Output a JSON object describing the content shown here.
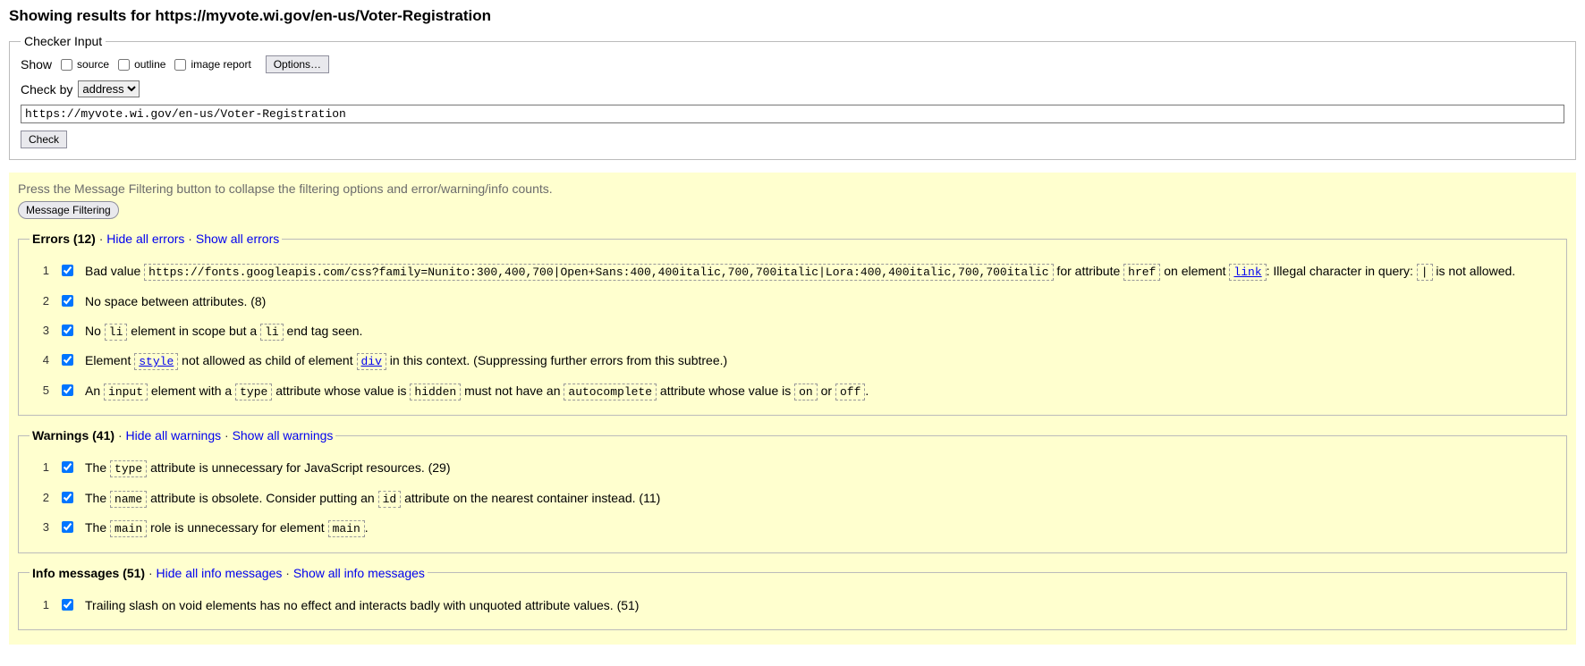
{
  "header": {
    "title_prefix": "Showing results for ",
    "title_url": "https://myvote.wi.gov/en-us/Voter-Registration"
  },
  "checker": {
    "legend": "Checker Input",
    "show_label": "Show",
    "source_label": "source",
    "outline_label": "outline",
    "image_report_label": "image report",
    "options_button": "Options…",
    "check_by_label": "Check by",
    "check_by_selected": "address",
    "url_value": "https://myvote.wi.gov/en-us/Voter-Registration",
    "check_button": "Check"
  },
  "filter": {
    "hint": "Press the Message Filtering button to collapse the filtering options and error/warning/info counts.",
    "button": "Message Filtering"
  },
  "errors": {
    "legend_label": "Errors (12)",
    "hide_link": "Hide all errors",
    "show_link": "Show all errors",
    "items": [
      {
        "num": "1",
        "parts": [
          {
            "t": "text",
            "v": "Bad value "
          },
          {
            "t": "code",
            "v": "https://fonts.googleapis.com/css?family=Nunito:300,400,700|Open+Sans:400,400italic,700,700italic|Lora:400,400italic,700,700italic"
          },
          {
            "t": "text",
            "v": " for attribute "
          },
          {
            "t": "code",
            "v": "href"
          },
          {
            "t": "text",
            "v": " on element "
          },
          {
            "t": "linkcode",
            "v": "link"
          },
          {
            "t": "text",
            "v": ": Illegal character in query: "
          },
          {
            "t": "code",
            "v": "|"
          },
          {
            "t": "text",
            "v": " is not allowed."
          }
        ]
      },
      {
        "num": "2",
        "parts": [
          {
            "t": "text",
            "v": "No space between attributes. (8)"
          }
        ]
      },
      {
        "num": "3",
        "parts": [
          {
            "t": "text",
            "v": "No "
          },
          {
            "t": "code",
            "v": "li"
          },
          {
            "t": "text",
            "v": " element in scope but a "
          },
          {
            "t": "code",
            "v": "li"
          },
          {
            "t": "text",
            "v": " end tag seen."
          }
        ]
      },
      {
        "num": "4",
        "parts": [
          {
            "t": "text",
            "v": "Element "
          },
          {
            "t": "linkcode",
            "v": "style"
          },
          {
            "t": "text",
            "v": " not allowed as child of element "
          },
          {
            "t": "linkcode",
            "v": "div"
          },
          {
            "t": "text",
            "v": " in this context. (Suppressing further errors from this subtree.)"
          }
        ]
      },
      {
        "num": "5",
        "parts": [
          {
            "t": "text",
            "v": "An "
          },
          {
            "t": "code",
            "v": "input"
          },
          {
            "t": "text",
            "v": " element with a "
          },
          {
            "t": "code",
            "v": "type"
          },
          {
            "t": "text",
            "v": " attribute whose value is "
          },
          {
            "t": "code",
            "v": "hidden"
          },
          {
            "t": "text",
            "v": " must not have an "
          },
          {
            "t": "code",
            "v": "autocomplete"
          },
          {
            "t": "text",
            "v": " attribute whose value is "
          },
          {
            "t": "code",
            "v": "on"
          },
          {
            "t": "text",
            "v": " or "
          },
          {
            "t": "code",
            "v": "off"
          },
          {
            "t": "text",
            "v": "."
          }
        ]
      }
    ]
  },
  "warnings": {
    "legend_label": "Warnings (41)",
    "hide_link": "Hide all warnings",
    "show_link": "Show all warnings",
    "items": [
      {
        "num": "1",
        "parts": [
          {
            "t": "text",
            "v": "The "
          },
          {
            "t": "code",
            "v": "type"
          },
          {
            "t": "text",
            "v": " attribute is unnecessary for JavaScript resources. (29)"
          }
        ]
      },
      {
        "num": "2",
        "parts": [
          {
            "t": "text",
            "v": "The "
          },
          {
            "t": "code",
            "v": "name"
          },
          {
            "t": "text",
            "v": " attribute is obsolete. Consider putting an "
          },
          {
            "t": "code",
            "v": "id"
          },
          {
            "t": "text",
            "v": " attribute on the nearest container instead. (11)"
          }
        ]
      },
      {
        "num": "3",
        "parts": [
          {
            "t": "text",
            "v": "The "
          },
          {
            "t": "code",
            "v": "main"
          },
          {
            "t": "text",
            "v": " role is unnecessary for element "
          },
          {
            "t": "code",
            "v": "main"
          },
          {
            "t": "text",
            "v": "."
          }
        ]
      }
    ]
  },
  "info": {
    "legend_label": "Info messages (51)",
    "hide_link": "Hide all info messages",
    "show_link": "Show all info messages",
    "items": [
      {
        "num": "1",
        "parts": [
          {
            "t": "text",
            "v": "Trailing slash on void elements has no effect and interacts badly with unquoted attribute values. (51)"
          }
        ]
      }
    ]
  }
}
